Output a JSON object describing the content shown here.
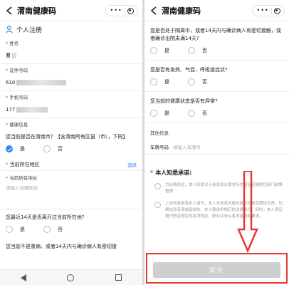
{
  "app": {
    "title": "渭南健康码"
  },
  "left": {
    "section_title": "个人注册",
    "fields": [
      {
        "label": "姓名",
        "value": "曹"
      },
      {
        "label": "证件号码",
        "value": "610"
      },
      {
        "label": "手机号码",
        "value": "177"
      },
      {
        "label": "健康信息",
        "value": ""
      }
    ],
    "q_weinan": "您当前是否在渭南市？【含渭南所有区县（市），下同】",
    "q_weinan_yes": "是",
    "q_weinan_no": "否",
    "current_region_label": "当前所在地区",
    "current_region_action": "选择",
    "current_address_label": "当前所在地址",
    "current_address_placeholder": "请输入详细地址",
    "q_left14": "您最近14天是否离开过当前所在地?",
    "q_left14_yes": "是",
    "q_left14_no": "否",
    "q_cut_off": "您当前不是重病、或者14天内与确诊病人有密切接"
  },
  "right": {
    "q_contact": "您是否处于隔离中，或者14天内与确诊病人有密切接触，或者确诊出院未满14天?",
    "q_contact_yes": "是",
    "q_contact_no": "否",
    "q_fever": "您是否有发热、气促、呼吸道症状?",
    "q_fever_yes": "是",
    "q_fever_no": "否",
    "q_family": "您当前的健康状态是否有异常?",
    "q_family_yes": "是",
    "q_family_no": "否",
    "other_info_label": "其他信息",
    "plate_label": "车牌号码",
    "plate_placeholder": "请输入车牌号",
    "commitment_title": "本人知悉承诺:",
    "pledge_1": "为疫情防控，本人同意以上信息依法提交所在辖区疫情防控部门统筹管理",
    "pledge_2": "上述信息是我本人填写，本人对信息内容的真实性和完整性负责。如果信息有误或者缺失，本人愿承担相应的法律责任。同时，本人保证遵守防疫管控的各项规定，配合并听从各项措施和要求。",
    "submit_label": "提交"
  },
  "colors": {
    "accent": "#2d87f0",
    "required": "#e53935",
    "annotation": "#e53935",
    "submit_disabled": "#cfcfcf"
  }
}
